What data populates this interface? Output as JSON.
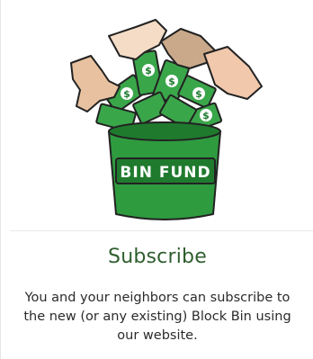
{
  "card": {
    "illustration": {
      "icon": "bin-fund-bucket-icon",
      "bucket_label": "BIN FUND",
      "money_symbol": "$",
      "colors": {
        "bucket": "#2e9b3f",
        "bucket_dark": "#1f7a2e",
        "money": "#3aa64a",
        "skin_light": "#f2d0b0",
        "skin_tan": "#d9b08c",
        "outline": "#222222"
      }
    },
    "title": "Subscribe",
    "description": {
      "line1": "You and your neighbors can subscribe to",
      "line2": "the new (or any existing) Block Bin using",
      "line3": "our website."
    }
  }
}
